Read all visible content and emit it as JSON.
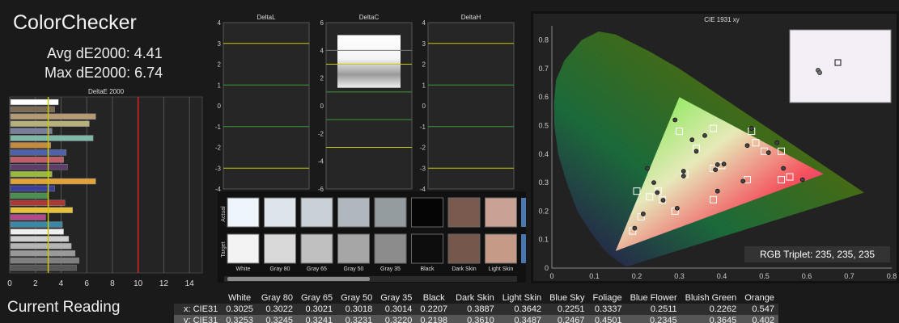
{
  "title": "ColorChecker",
  "avg_label": "Avg dE2000: 4.41",
  "max_label": "Max dE2000: 6.74",
  "current_reading": "Current Reading",
  "rgb_triplet": "RGB Triplet: 235, 235, 235",
  "colors": {
    "background": "#1a1a1a",
    "panel": "#222222",
    "grid": "#555555",
    "target_line": "#c8c800",
    "limit_line": "#e02020"
  },
  "chart_data": [
    {
      "type": "bar",
      "title": "DeltaE 2000",
      "orientation": "horizontal",
      "xlim": [
        0,
        15
      ],
      "xticks": [
        0,
        2,
        4,
        6,
        8,
        10,
        12,
        14
      ],
      "marker_lines": [
        3,
        10
      ],
      "values": [
        3.8,
        3.5,
        6.7,
        6.2,
        3.3,
        6.5,
        3.2,
        4.4,
        4.2,
        4.5,
        3.3,
        6.7,
        3.5,
        3.0,
        4.3,
        4.9,
        2.8,
        4.1,
        4.2,
        4.6,
        4.8,
        5.1,
        5.4,
        5.2
      ],
      "bar_colors": [
        "#ffffff",
        "#7b6a55",
        "#b59a73",
        "#b8b07a",
        "#7a7f9e",
        "#7fb8a8",
        "#c48a3a",
        "#4f61a8",
        "#c25b6a",
        "#5d3e6b",
        "#9ab83d",
        "#e2a23a",
        "#3a3f9a",
        "#4a8f4e",
        "#a83a36",
        "#e6c23a",
        "#b04a8a",
        "#3a87a8",
        "#f0f0f0",
        "#cfcfcf",
        "#b5b5b5",
        "#9a9a9a",
        "#7f7f7f",
        "#555555"
      ]
    },
    {
      "type": "line",
      "title": "DeltaL",
      "ylim": [
        -4,
        4
      ],
      "yticks": [
        4,
        3,
        2,
        1,
        0,
        -1,
        -2,
        -3,
        -4
      ]
    },
    {
      "type": "line",
      "title": "DeltaC",
      "ylim": [
        -6,
        6
      ],
      "yticks": [
        6,
        4,
        2,
        0,
        -2,
        -4,
        -6
      ]
    },
    {
      "type": "line",
      "title": "DeltaH",
      "ylim": [
        -4,
        4
      ],
      "yticks": [
        4,
        3,
        2,
        1,
        0,
        -1,
        -2,
        -3,
        -4
      ]
    },
    {
      "type": "scatter",
      "title": "CIE 1931 xy",
      "xlim": [
        0,
        0.8
      ],
      "ylim": [
        0,
        0.85
      ],
      "xticks": [
        "0",
        "0.1",
        "0.2",
        "0.3",
        "0.4",
        "0.5",
        "0.6",
        "0.7",
        "0.8"
      ],
      "yticks": [
        "0.8",
        "0.7",
        "0.6",
        "0.5",
        "0.4",
        "0.3",
        "0.2",
        "0.1",
        "0"
      ],
      "gamut": [
        [
          0.64,
          0.33
        ],
        [
          0.3,
          0.6
        ],
        [
          0.15,
          0.06
        ]
      ],
      "targets": [
        [
          0.3127,
          0.329
        ],
        [
          0.4,
          0.36
        ],
        [
          0.38,
          0.35
        ],
        [
          0.25,
          0.27
        ],
        [
          0.34,
          0.42
        ],
        [
          0.26,
          0.24
        ],
        [
          0.5,
          0.41
        ],
        [
          0.21,
          0.18
        ],
        [
          0.46,
          0.31
        ],
        [
          0.29,
          0.2
        ],
        [
          0.38,
          0.49
        ],
        [
          0.48,
          0.44
        ],
        [
          0.19,
          0.13
        ],
        [
          0.3,
          0.48
        ],
        [
          0.54,
          0.31
        ],
        [
          0.47,
          0.48
        ],
        [
          0.38,
          0.24
        ],
        [
          0.2,
          0.27
        ],
        [
          0.56,
          0.32
        ],
        [
          0.54,
          0.41
        ],
        [
          0.23,
          0.25
        ]
      ],
      "actuals": [
        [
          0.31,
          0.323
        ],
        [
          0.39,
          0.363
        ],
        [
          0.385,
          0.345
        ],
        [
          0.248,
          0.265
        ],
        [
          0.34,
          0.41
        ],
        [
          0.262,
          0.238
        ],
        [
          0.51,
          0.405
        ],
        [
          0.215,
          0.19
        ],
        [
          0.45,
          0.305
        ],
        [
          0.295,
          0.21
        ],
        [
          0.36,
          0.465
        ],
        [
          0.46,
          0.43
        ],
        [
          0.195,
          0.14
        ],
        [
          0.29,
          0.52
        ],
        [
          0.545,
          0.35
        ],
        [
          0.47,
          0.49
        ],
        [
          0.39,
          0.27
        ],
        [
          0.225,
          0.35
        ],
        [
          0.59,
          0.31
        ],
        [
          0.53,
          0.44
        ],
        [
          0.24,
          0.3
        ],
        [
          0.33,
          0.45
        ],
        [
          0.31,
          0.34
        ],
        [
          0.405,
          0.365
        ]
      ]
    }
  ],
  "swatch_labels": [
    "White",
    "Gray 80",
    "Gray 65",
    "Gray 50",
    "Gray 35",
    "Black",
    "Dark Skin",
    "Light Skin"
  ],
  "swatch_actual": [
    "#eef6fb",
    "#dde5ea",
    "#c9d1d6",
    "#b0b8bd",
    "#959ca0",
    "#050505",
    "#7a5a4e",
    "#c9a294"
  ],
  "swatch_target": [
    "#f3f3f3",
    "#d9d9d9",
    "#c0c0c0",
    "#a6a6a6",
    "#8c8c8c",
    "#0d0d0d",
    "#76574c",
    "#c59a86"
  ],
  "swatch_side_labels": {
    "actual": "Actual",
    "target": "Target"
  },
  "table": {
    "headers": [
      "",
      "White",
      "Gray 80",
      "Gray 65",
      "Gray 50",
      "Gray 35",
      "Black",
      "Dark Skin",
      "Light Skin",
      "Blue Sky",
      "Foliage",
      "Blue Flower",
      "Bluish Green",
      "Orange"
    ],
    "rows": [
      [
        "x: CIE31",
        "0.3025",
        "0.3022",
        "0.3021",
        "0.3018",
        "0.3014",
        "0.2207",
        "0.3887",
        "0.3642",
        "0.2251",
        "0.3337",
        "0.2511",
        "0.2262",
        "0.547"
      ],
      [
        "y: CIE31",
        "0.3253",
        "0.3245",
        "0.3241",
        "0.3231",
        "0.3220",
        "0.2198",
        "0.3610",
        "0.3487",
        "0.2467",
        "0.4501",
        "0.2345",
        "0.3645",
        "0.402"
      ]
    ]
  }
}
